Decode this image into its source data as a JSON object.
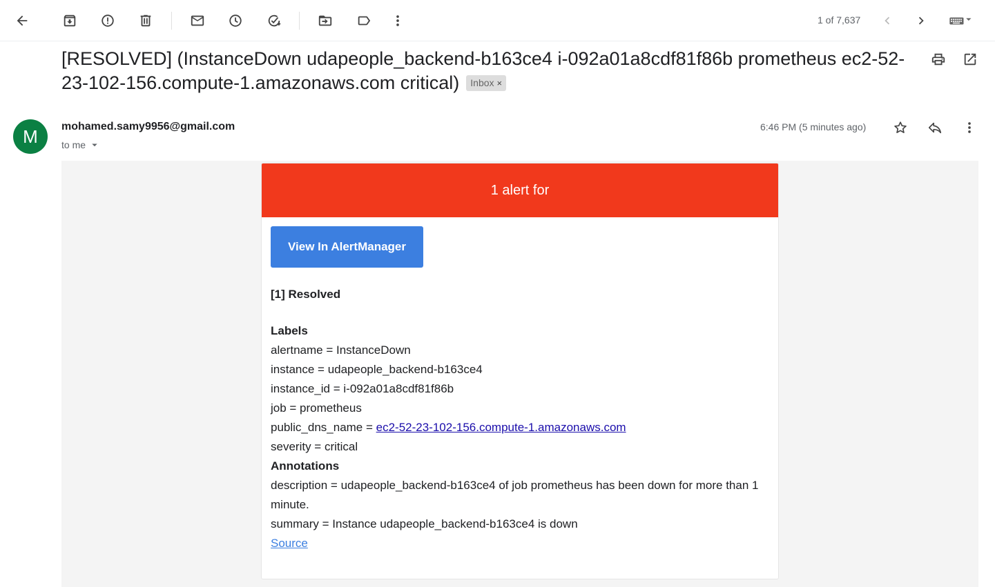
{
  "toolbar": {
    "pager_text": "1 of 7,637"
  },
  "icons": {
    "back": "arrow-left",
    "archive": "archive",
    "spam": "report-spam",
    "delete": "trash",
    "unread": "mail",
    "snooze": "clock",
    "task": "add-task",
    "move": "move-to-folder",
    "label": "label",
    "more": "more-vertical",
    "prev": "chevron-left",
    "next": "chevron-right",
    "keyboard": "keyboard",
    "print": "print",
    "open_new": "open-in-new",
    "star": "star",
    "reply": "reply"
  },
  "message": {
    "subject": "[RESOLVED] (InstanceDown udapeople_backend-b163ce4 i-092a01a8cdf81f86b prometheus ec2-52-23-102-156.compute-1.amazonaws.com critical)",
    "label": "Inbox",
    "avatar_letter": "M",
    "sender": "mohamed.samy9956@gmail.com",
    "to": "to me",
    "time": "6:46 PM (5 minutes ago)"
  },
  "email_body": {
    "header": "1 alert for",
    "button": "View In AlertManager",
    "resolved_title": "[1] Resolved",
    "labels_heading": "Labels",
    "alertname": "alertname = InstanceDown",
    "instance": "instance = udapeople_backend-b163ce4",
    "instance_id": "instance_id = i-092a01a8cdf81f86b",
    "job": "job = prometheus",
    "public_dns_prefix": "public_dns_name = ",
    "public_dns_link": "ec2-52-23-102-156.compute-1.amazonaws.com",
    "severity": "severity = critical",
    "annotations_heading": "Annotations",
    "description": "description = udapeople_backend-b163ce4 of job prometheus has been down for more than 1 minute.",
    "summary": "summary = Instance udapeople_backend-b163ce4 is down",
    "source_link": "Source"
  },
  "colors": {
    "alert_header": "#f1391c",
    "button": "#3c7fe0",
    "avatar": "#0b8043"
  }
}
